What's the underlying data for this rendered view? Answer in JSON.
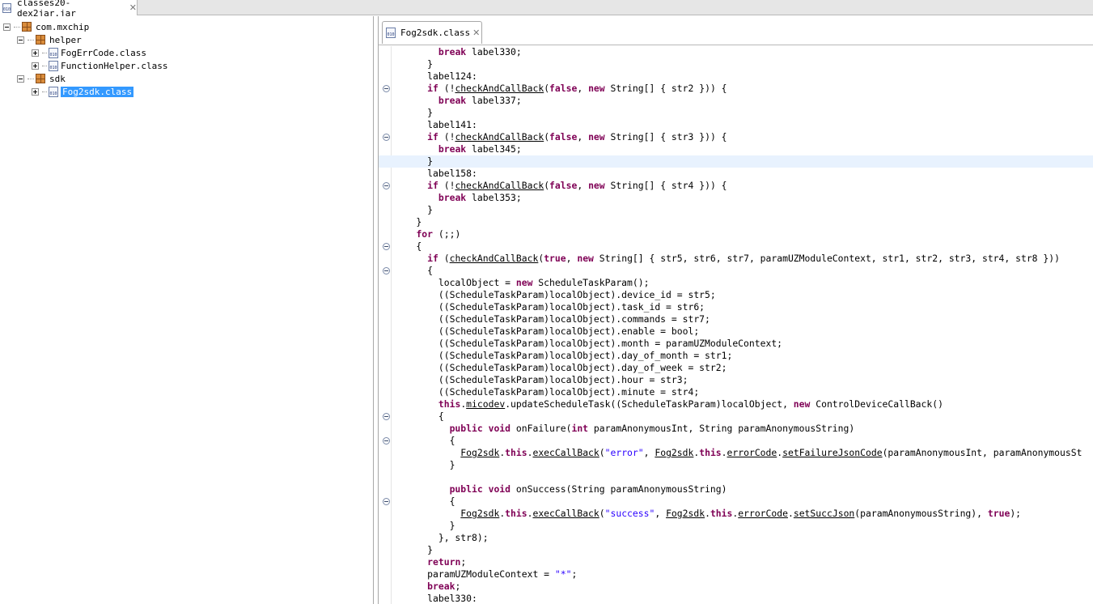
{
  "window": {
    "tab_label": "classes20-dex2jar.jar",
    "close_glyph": "✕"
  },
  "tree": {
    "items": [
      {
        "label": "com.mxchip",
        "icon": "package-icon",
        "toggle": "minus"
      },
      {
        "label": "helper",
        "icon": "package-icon",
        "toggle": "minus"
      },
      {
        "label": "FogErrCode.class",
        "icon": "class-file-icon",
        "toggle": "plus"
      },
      {
        "label": "FunctionHelper.class",
        "icon": "class-file-icon",
        "toggle": "plus"
      },
      {
        "label": "sdk",
        "icon": "package-icon",
        "toggle": "minus"
      },
      {
        "label": "Fog2sdk.class",
        "icon": "class-file-icon",
        "toggle": "plus",
        "selected": true
      }
    ]
  },
  "editor": {
    "tab_label": "Fog2sdk.class",
    "close_glyph": "✕",
    "file_icon_text": "010",
    "highlighted_line": 9,
    "lines": [
      "        break label330;",
      "      }",
      "      label124:",
      "      if (!checkAndCallBack(false, new String[] { str2 })) {",
      "        break label337;",
      "      }",
      "      label141:",
      "      if (!checkAndCallBack(false, new String[] { str3 })) {",
      "        break label345;",
      "      }",
      "      label158:",
      "      if (!checkAndCallBack(false, new String[] { str4 })) {",
      "        break label353;",
      "      }",
      "    }",
      "    for (;;)",
      "    {",
      "      if (checkAndCallBack(true, new String[] { str5, str6, str7, paramUZModuleContext, str1, str2, str3, str4, str8 }))",
      "      {",
      "        localObject = new ScheduleTaskParam();",
      "        ((ScheduleTaskParam)localObject).device_id = str5;",
      "        ((ScheduleTaskParam)localObject).task_id = str6;",
      "        ((ScheduleTaskParam)localObject).commands = str7;",
      "        ((ScheduleTaskParam)localObject).enable = bool;",
      "        ((ScheduleTaskParam)localObject).month = paramUZModuleContext;",
      "        ((ScheduleTaskParam)localObject).day_of_month = str1;",
      "        ((ScheduleTaskParam)localObject).day_of_week = str2;",
      "        ((ScheduleTaskParam)localObject).hour = str3;",
      "        ((ScheduleTaskParam)localObject).minute = str4;",
      "        this.micodev.updateScheduleTask((ScheduleTaskParam)localObject, new ControlDeviceCallBack()",
      "        {",
      "          public void onFailure(int paramAnonymousInt, String paramAnonymousString)",
      "          {",
      "            Fog2sdk.this.execCallBack(\"error\", Fog2sdk.this.errorCode.setFailureJsonCode(paramAnonymousInt, paramAnonymousSt",
      "          }",
      "",
      "          public void onSuccess(String paramAnonymousString)",
      "          {",
      "            Fog2sdk.this.execCallBack(\"success\", Fog2sdk.this.errorCode.setSuccJson(paramAnonymousString), true);",
      "          }",
      "        }, str8);",
      "      }",
      "      return;",
      "      paramUZModuleContext = \"*\";",
      "      break;",
      "      label330:"
    ],
    "fold_lines": [
      3,
      7,
      11,
      16,
      18,
      30,
      32,
      37
    ]
  }
}
